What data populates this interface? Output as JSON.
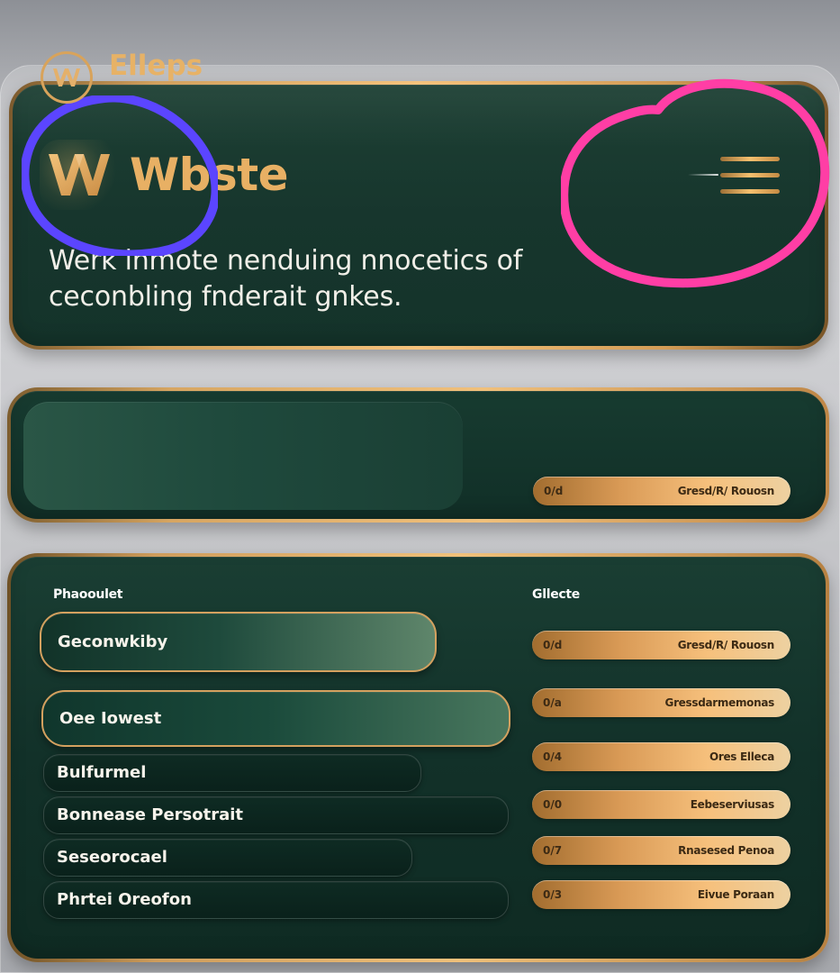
{
  "header": {
    "brand_name": "Wbste",
    "copy_line_1": "Werk inmote nenduing nnocetics of",
    "copy_line_2": "ceconbling fnderait gnkes."
  },
  "hero_section": {
    "menu_icon": "hamburger-menu-icon",
    "logo_icon": "w-logo-icon"
  },
  "feature_section": {
    "title": "Elleps",
    "logo_icon": "circle-w-logo-icon",
    "pill": {
      "left_text": "0/d",
      "right_text": "Gresd/R/ Rouosn"
    }
  },
  "form_section": {
    "left_label": "Phaooulet",
    "right_label": "Gllecte",
    "options": [
      {
        "label": "Geconwkiby"
      },
      {
        "label": "Oee  Iowest"
      },
      {
        "label": "Bulfurmel"
      },
      {
        "label": "Bonnease Persotrait"
      },
      {
        "label": "Seseorocael"
      },
      {
        "label": "Phrtei  Oreofon"
      }
    ],
    "pills": [
      {
        "left_text": "0/d",
        "right_text": "Gresd/R/ Rouosn"
      },
      {
        "left_text": "0/a",
        "right_text": "Gressdarmemonas"
      },
      {
        "left_text": "0/4",
        "right_text": "Ores  Elleca"
      },
      {
        "left_text": "0/0",
        "right_text": "Eebeserviusas"
      },
      {
        "left_text": "0/7",
        "right_text": "Rnasesed Penoa"
      },
      {
        "left_text": "0/3",
        "right_text": "Eivue Poraan"
      }
    ]
  },
  "annotations": {
    "blue_color": "#5b45ff",
    "pink_color": "#ff3ea5"
  }
}
